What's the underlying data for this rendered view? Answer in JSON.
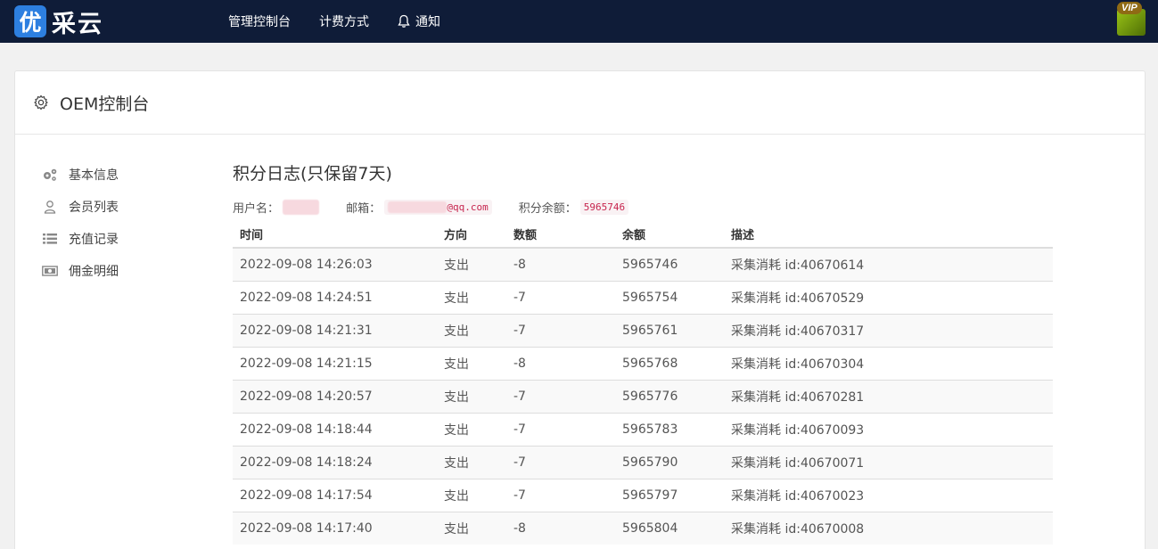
{
  "app": {
    "logo_badge": "优",
    "logo_text": "采云",
    "vip_label": "VIP"
  },
  "nav": {
    "items": [
      {
        "label": "管理控制台"
      },
      {
        "label": "计费方式"
      },
      {
        "label": "通知",
        "icon": "bell-icon"
      }
    ]
  },
  "page": {
    "title": "OEM控制台"
  },
  "sidebar": {
    "items": [
      {
        "label": "基本信息",
        "icon": "gears-icon"
      },
      {
        "label": "会员列表",
        "icon": "user-icon"
      },
      {
        "label": "充值记录",
        "icon": "list-icon"
      },
      {
        "label": "佣金明细",
        "icon": "money-icon"
      }
    ]
  },
  "log": {
    "title": "积分日志(只保留7天)",
    "username_label": "用户名：",
    "email_label": "邮箱：",
    "email_value": "@qq.com",
    "balance_label": "积分余额：",
    "balance_value": "5965746"
  },
  "table": {
    "headers": [
      "时间",
      "方向",
      "数额",
      "余额",
      "描述"
    ],
    "rows": [
      [
        "2022-09-08 14:26:03",
        "支出",
        "-8",
        "5965746",
        "采集消耗 id:40670614"
      ],
      [
        "2022-09-08 14:24:51",
        "支出",
        "-7",
        "5965754",
        "采集消耗 id:40670529"
      ],
      [
        "2022-09-08 14:21:31",
        "支出",
        "-7",
        "5965761",
        "采集消耗 id:40670317"
      ],
      [
        "2022-09-08 14:21:15",
        "支出",
        "-8",
        "5965768",
        "采集消耗 id:40670304"
      ],
      [
        "2022-09-08 14:20:57",
        "支出",
        "-7",
        "5965776",
        "采集消耗 id:40670281"
      ],
      [
        "2022-09-08 14:18:44",
        "支出",
        "-7",
        "5965783",
        "采集消耗 id:40670093"
      ],
      [
        "2022-09-08 14:18:24",
        "支出",
        "-7",
        "5965790",
        "采集消耗 id:40670071"
      ],
      [
        "2022-09-08 14:17:54",
        "支出",
        "-7",
        "5965797",
        "采集消耗 id:40670023"
      ],
      [
        "2022-09-08 14:17:40",
        "支出",
        "-8",
        "5965804",
        "采集消耗 id:40670008"
      ]
    ]
  },
  "colors": {
    "topbar": "#0f1c38",
    "accent": "#2d7fe0",
    "code_text": "#c7254e"
  }
}
